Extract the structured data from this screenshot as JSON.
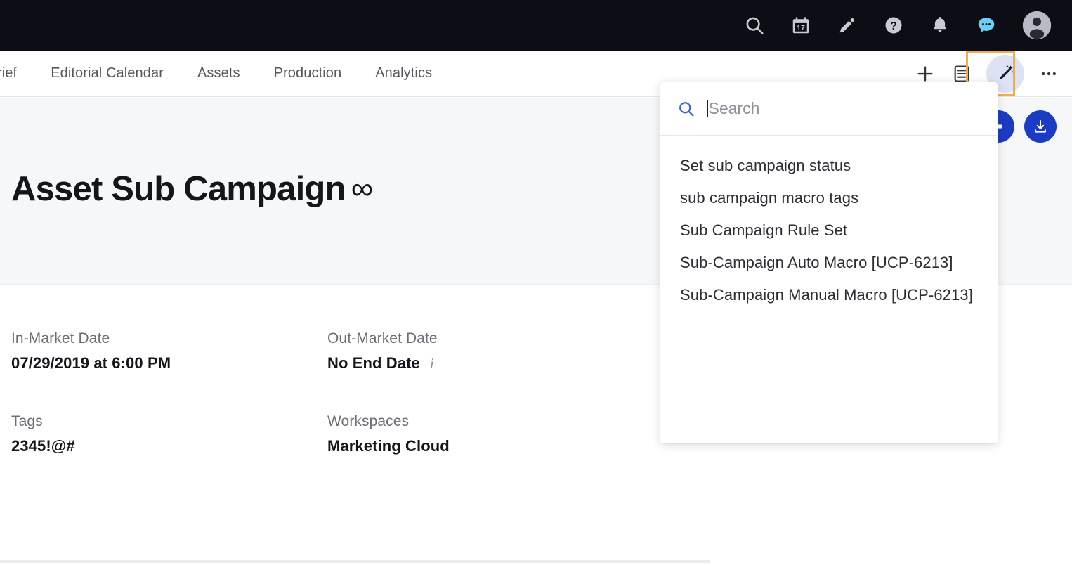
{
  "topbar": {
    "icons": [
      {
        "name": "search-icon",
        "label": "Search"
      },
      {
        "name": "calendar-icon",
        "label": "Calendar",
        "day": "17"
      },
      {
        "name": "pencil-icon",
        "label": "Create"
      },
      {
        "name": "help-icon",
        "label": "Help"
      },
      {
        "name": "bell-icon",
        "label": "Notifications"
      },
      {
        "name": "chat-icon",
        "label": "Messages",
        "color": "#6ad0f7"
      },
      {
        "name": "avatar-icon",
        "label": "Account"
      }
    ]
  },
  "nav": {
    "tabs": [
      {
        "label": "rief"
      },
      {
        "label": "Editorial Calendar"
      },
      {
        "label": "Assets"
      },
      {
        "label": "Production"
      },
      {
        "label": "Analytics"
      }
    ],
    "actions": [
      {
        "name": "add-button",
        "label": "Add"
      },
      {
        "name": "list-view-button",
        "label": "List view"
      },
      {
        "name": "magic-wand-button",
        "label": "Macros"
      },
      {
        "name": "more-options-button",
        "label": "More options"
      }
    ]
  },
  "header": {
    "title": "Asset Sub Campaign",
    "title_suffix": "∞",
    "actions": [
      {
        "name": "share-button",
        "label": "Share"
      },
      {
        "name": "download-button",
        "label": "Download"
      }
    ]
  },
  "fields": [
    [
      {
        "label": "In-Market Date",
        "value": "07/29/2019 at 6:00 PM",
        "info": ""
      },
      {
        "label": "Out-Market Date",
        "value": "No End Date",
        "info": "i"
      }
    ],
    [
      {
        "label": "Tags",
        "value": "2345!@#",
        "info": ""
      },
      {
        "label": "Workspaces",
        "value": "Marketing Cloud",
        "info": ""
      }
    ]
  ],
  "dropdown": {
    "search": {
      "placeholder": "Search",
      "value": ""
    },
    "items": [
      {
        "label": "Set sub campaign status"
      },
      {
        "label": "sub campaign macro tags"
      },
      {
        "label": "Sub Campaign Rule Set"
      },
      {
        "label": "Sub-Campaign Auto Macro [UCP-6213]"
      },
      {
        "label": "Sub-Campaign Manual Macro [UCP-6213]"
      }
    ]
  },
  "colors": {
    "topbar_bg": "#0d0d15",
    "header_band_bg": "#f6f7f9",
    "accent_blue": "#1b3bc4",
    "search_icon_blue": "#3d60e0",
    "highlight_orange": "#f2ad4a",
    "chat_blue": "#6ad0f7",
    "wand_circle": "#dde2f5"
  }
}
